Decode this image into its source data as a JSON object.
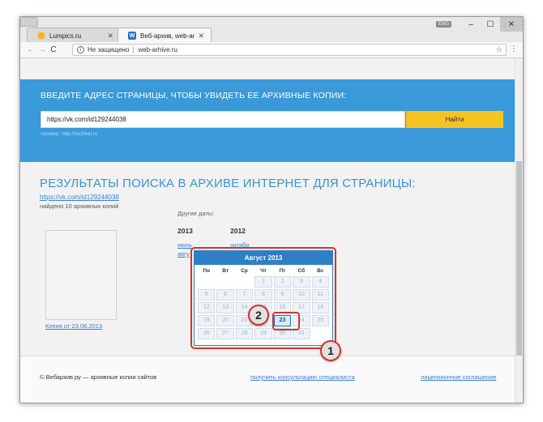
{
  "browser": {
    "tabs": [
      {
        "title": "Lumpics.ru",
        "favicon": "sun-icon"
      },
      {
        "title": "Веб-архив, web-archive",
        "favicon": "w-icon"
      }
    ],
    "lang": "ENG",
    "security_text": "Не защищено",
    "url": "web-arhive.ru"
  },
  "page": {
    "band_title": "ВВЕДИТЕ АДРЕС СТРАНИЦЫ, ЧТОБЫ УВИДЕТЬ ЕЕ АРХИВНЫЕ КОПИИ:",
    "search_value": "https://vk.com/id129244038",
    "find_label": "Найти",
    "example": "пример: http://tochkal.ru",
    "results_title": "РЕЗУЛЬТАТЫ ПОИСКА В АРХИВЕ ИНТЕРНЕТ ДЛЯ СТРАНИЦЫ:",
    "result_link": "https://vk.com/id129244038",
    "result_count": "найдено 10 архивных копий",
    "other_dates": "Другие даты:",
    "years": [
      {
        "label": "2013",
        "months": [
          "июль",
          "авгу"
        ]
      },
      {
        "label": "2012",
        "months": [
          "октябр"
        ]
      }
    ],
    "copy_link": "Копия от 23.08.2013"
  },
  "calendar": {
    "title": "Август 2013",
    "weekdays": [
      "Пн",
      "Вт",
      "Ср",
      "Чт",
      "Пт",
      "Сб",
      "Вс"
    ],
    "weeks": [
      [
        "",
        "",
        "",
        "1",
        "2",
        "3",
        "4"
      ],
      [
        "5",
        "6",
        "7",
        "8",
        "9",
        "10",
        "11"
      ],
      [
        "12",
        "13",
        "14",
        "15",
        "16",
        "17",
        "18"
      ],
      [
        "19",
        "20",
        "21",
        "22",
        "23",
        "24",
        "25"
      ],
      [
        "26",
        "27",
        "28",
        "29",
        "30",
        "31",
        ""
      ]
    ],
    "selected_day": "23"
  },
  "markers": {
    "one": "1",
    "two": "2"
  },
  "footer": {
    "copyright": "© Вебархив.ру — архивные копии сайтов",
    "consult": "получить консультацию специалиста",
    "license": "лицензионное соглашение"
  },
  "colors": {
    "accent": "#3a9ad9",
    "button": "#f6c320",
    "highlight": "#d9312e"
  }
}
